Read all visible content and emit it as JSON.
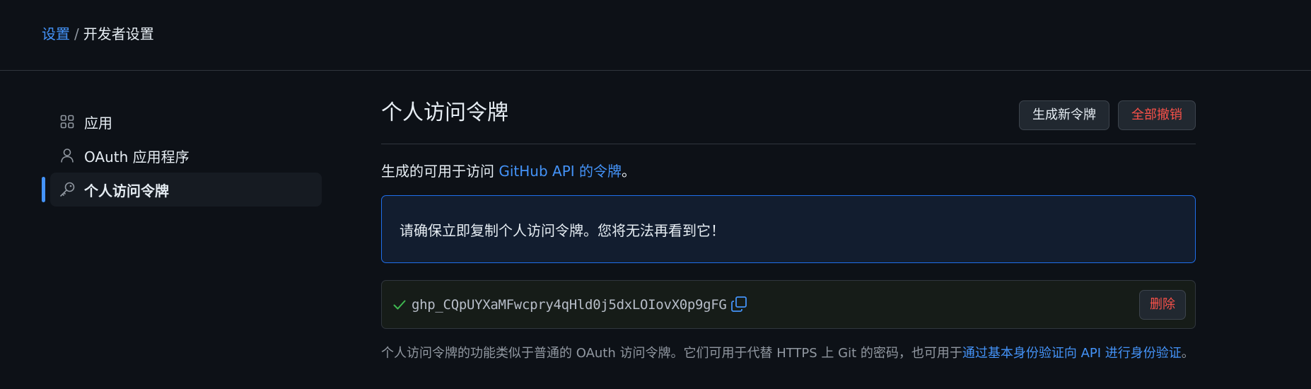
{
  "breadcrumb": {
    "settings": "设置",
    "separator": "/",
    "current": "开发者设置"
  },
  "sidebar": {
    "items": [
      {
        "label": "应用",
        "icon": "apps-icon"
      },
      {
        "label": "OAuth 应用程序",
        "icon": "person-icon"
      },
      {
        "label": "个人访问令牌",
        "icon": "key-icon",
        "active": true
      }
    ]
  },
  "main": {
    "title": "个人访问令牌",
    "generate_button": "生成新令牌",
    "revoke_all_button": "全部撤销",
    "description_prefix": "生成的可用于访问 ",
    "description_link": "GitHub API 的令牌",
    "description_suffix": "。",
    "flash_message": "请确保立即复制个人访问令牌。您将无法再看到它！",
    "token": {
      "value": "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",
      "delete_button": "删除"
    },
    "footnote_prefix": "个人访问令牌的功能类似于普通的 OAuth 访问令牌。它们可用于代替 HTTPS 上 Git 的密码，也可用于",
    "footnote_link": "通过基本身份验证向 API 进行身份验证",
    "footnote_suffix": "。"
  },
  "colors": {
    "background": "#0d1117",
    "link": "#4493f8",
    "danger": "#f85149",
    "success": "#3fb950",
    "flash_border": "#1f6feb"
  }
}
